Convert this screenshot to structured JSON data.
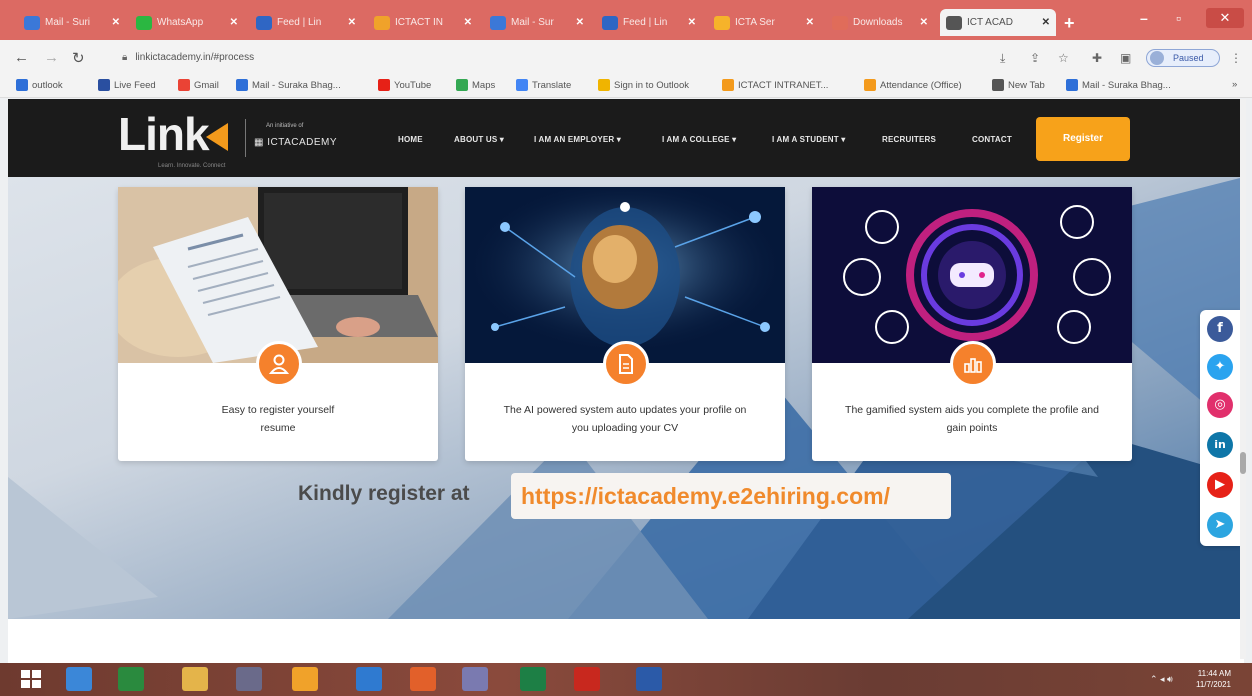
{
  "browser": {
    "tabs": [
      {
        "label": "Mail - Suri",
        "color": "#3b78d8",
        "active": false
      },
      {
        "label": "WhatsApp",
        "color": "#2bb741",
        "active": false
      },
      {
        "label": "Feed | Lin",
        "color": "#2f66c4",
        "active": false
      },
      {
        "label": "ICTACT IN",
        "color": "#f0a22a",
        "active": false
      },
      {
        "label": "Mail - Sur",
        "color": "#3b78d8",
        "active": false
      },
      {
        "label": "Feed | Lin",
        "color": "#2f66c4",
        "active": false
      },
      {
        "label": "ICTA Ser",
        "color": "#f6b32a",
        "active": false
      },
      {
        "label": "Downloads",
        "color": "#e06c5a",
        "active": false
      },
      {
        "label": "ICT ACAD",
        "color": "#555555",
        "active": true
      }
    ],
    "new_tab": "+",
    "window_controls": {
      "minimize": "–",
      "maximize": "▫",
      "close": "✕"
    },
    "url": "linkictacademy.in/#process",
    "profile_label": "Paused",
    "bookmarks": [
      {
        "label": "outlook",
        "color": "#2e6fd8"
      },
      {
        "label": "Live Feed",
        "color": "#2a4fa0"
      },
      {
        "label": "Gmail",
        "color": "#ea4335"
      },
      {
        "label": "Mail - Suraka Bhag...",
        "color": "#2e6fd8"
      },
      {
        "label": "YouTube",
        "color": "#e62117"
      },
      {
        "label": "Maps",
        "color": "#34a853"
      },
      {
        "label": "Translate",
        "color": "#4285f4"
      },
      {
        "label": "Sign in to Outlook",
        "color": "#f0b400"
      },
      {
        "label": "ICTACT INTRANET...",
        "color": "#f39a1c"
      },
      {
        "label": "Attendance (Office)",
        "color": "#f39a1c"
      },
      {
        "label": "New Tab",
        "color": "#555555"
      },
      {
        "label": "Mail - Suraka Bhag...",
        "color": "#2e6fd8"
      }
    ]
  },
  "site": {
    "logo_text": "Link",
    "logo_tagline": "Learn. Innovate. Connect",
    "initiative_label": "An initiative of",
    "ict_logo": "ICTACADEMY",
    "menu": [
      {
        "label": "HOME"
      },
      {
        "label": "ABOUT US ▾"
      },
      {
        "label": "I AM AN EMPLOYER ▾"
      },
      {
        "label": "I AM A COLLEGE ▾"
      },
      {
        "label": "I AM A STUDENT ▾"
      },
      {
        "label": "RECRUITERS"
      },
      {
        "label": "CONTACT"
      }
    ],
    "register_button": "Register",
    "cards": [
      {
        "icon": "user-icon",
        "text_line1": "Easy to register yourself",
        "text_line2": "resume"
      },
      {
        "icon": "document-icon",
        "text_line1": "The AI powered system auto updates your profile on",
        "text_line2": "you uploading your CV"
      },
      {
        "icon": "chart-icon",
        "text_line1": "The gamified system aids you complete the profile and",
        "text_line2": "gain points"
      }
    ],
    "register_prompt": "Kindly register at",
    "register_url": "https://ictacademy.e2ehiring.com/",
    "social": [
      "facebook",
      "twitter",
      "instagram",
      "linkedin",
      "youtube",
      "telegram"
    ]
  },
  "taskbar": {
    "clock_time": "11:44 AM",
    "clock_date": "11/7/2021"
  }
}
